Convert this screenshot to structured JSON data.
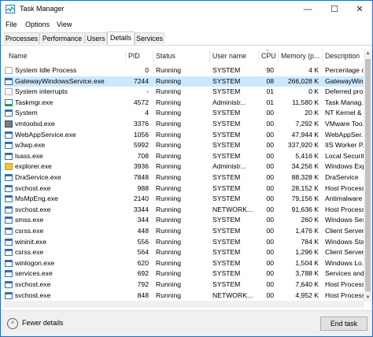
{
  "window": {
    "title": "Task Manager"
  },
  "menu": [
    "File",
    "Options",
    "View"
  ],
  "tabs": [
    {
      "label": "Processes",
      "active": false
    },
    {
      "label": "Performance",
      "active": false
    },
    {
      "label": "Users",
      "active": false
    },
    {
      "label": "Details",
      "active": true
    },
    {
      "label": "Services",
      "active": false
    }
  ],
  "table": {
    "columns": [
      "Name",
      "PID",
      "Status",
      "User name",
      "CPU",
      "Memory (p...",
      "Description"
    ],
    "rows": [
      {
        "name": "System Idle Process",
        "pid": "0",
        "status": "Running",
        "user": "SYSTEM",
        "cpu": "90",
        "memory": "4 K",
        "description": "Percentage of ...",
        "icon": "process-icon",
        "selected": false
      },
      {
        "name": "GatewayWindowsService.exe",
        "pid": "7244",
        "status": "Running",
        "user": "SYSTEM",
        "cpu": "08",
        "memory": "266,028 K",
        "description": "GatewayWin...",
        "icon": "window-icon",
        "selected": true
      },
      {
        "name": "System interrupts",
        "pid": "-",
        "status": "Running",
        "user": "SYSTEM",
        "cpu": "01",
        "memory": "0 K",
        "description": "Deferred pro...",
        "icon": "process-icon",
        "selected": false
      },
      {
        "name": "Taskmgr.exe",
        "pid": "4572",
        "status": "Running",
        "user": "Administr...",
        "cpu": "01",
        "memory": "11,580 K",
        "description": "Task Manag...",
        "icon": "taskmgr-icon",
        "selected": false
      },
      {
        "name": "System",
        "pid": "4",
        "status": "Running",
        "user": "SYSTEM",
        "cpu": "00",
        "memory": "20 K",
        "description": "NT Kernel & ...",
        "icon": "window-icon",
        "selected": false
      },
      {
        "name": "vmtoolsd.exe",
        "pid": "3376",
        "status": "Running",
        "user": "SYSTEM",
        "cpu": "00",
        "memory": "7,292 K",
        "description": "VMware Too...",
        "icon": "vm-icon",
        "selected": false
      },
      {
        "name": "WebAppService.exe",
        "pid": "1056",
        "status": "Running",
        "user": "SYSTEM",
        "cpu": "00",
        "memory": "47,944 K",
        "description": "WebAppSer...",
        "icon": "window-icon",
        "selected": false
      },
      {
        "name": "w3wp.exe",
        "pid": "5992",
        "status": "Running",
        "user": "SYSTEM",
        "cpu": "00",
        "memory": "337,920 K",
        "description": "IIS Worker P...",
        "icon": "window-icon",
        "selected": false
      },
      {
        "name": "lsass.exe",
        "pid": "708",
        "status": "Running",
        "user": "SYSTEM",
        "cpu": "00",
        "memory": "5,416 K",
        "description": "Local Securit...",
        "icon": "window-icon",
        "selected": false
      },
      {
        "name": "explorer.exe",
        "pid": "3936",
        "status": "Running",
        "user": "Administr...",
        "cpu": "00",
        "memory": "34,256 K",
        "description": "Windows Exp...",
        "icon": "folder-icon",
        "selected": false
      },
      {
        "name": "DraService.exe",
        "pid": "7848",
        "status": "Running",
        "user": "SYSTEM",
        "cpu": "00",
        "memory": "88,328 K",
        "description": "DraService",
        "icon": "window-icon",
        "selected": false
      },
      {
        "name": "svchost.exe",
        "pid": "988",
        "status": "Running",
        "user": "SYSTEM",
        "cpu": "00",
        "memory": "28,152 K",
        "description": "Host Process ...",
        "icon": "window-icon",
        "selected": false
      },
      {
        "name": "MsMpEng.exe",
        "pid": "2140",
        "status": "Running",
        "user": "SYSTEM",
        "cpu": "00",
        "memory": "79,156 K",
        "description": "Antimalware ...",
        "icon": "window-icon",
        "selected": false
      },
      {
        "name": "svchost.exe",
        "pid": "3344",
        "status": "Running",
        "user": "NETWORK...",
        "cpu": "00",
        "memory": "91,636 K",
        "description": "Host Process ...",
        "icon": "window-icon",
        "selected": false
      },
      {
        "name": "smss.exe",
        "pid": "344",
        "status": "Running",
        "user": "SYSTEM",
        "cpu": "00",
        "memory": "260 K",
        "description": "Windows Ses...",
        "icon": "window-icon",
        "selected": false
      },
      {
        "name": "csrss.exe",
        "pid": "448",
        "status": "Running",
        "user": "SYSTEM",
        "cpu": "00",
        "memory": "1,476 K",
        "description": "Client Server ...",
        "icon": "window-icon",
        "selected": false
      },
      {
        "name": "wininit.exe",
        "pid": "556",
        "status": "Running",
        "user": "SYSTEM",
        "cpu": "00",
        "memory": "784 K",
        "description": "Windows Sta...",
        "icon": "window-icon",
        "selected": false
      },
      {
        "name": "csrss.exe",
        "pid": "564",
        "status": "Running",
        "user": "SYSTEM",
        "cpu": "00",
        "memory": "1,296 K",
        "description": "Client Server ...",
        "icon": "window-icon",
        "selected": false
      },
      {
        "name": "winlogon.exe",
        "pid": "620",
        "status": "Running",
        "user": "SYSTEM",
        "cpu": "00",
        "memory": "1,504 K",
        "description": "Windows Lo...",
        "icon": "window-icon",
        "selected": false
      },
      {
        "name": "services.exe",
        "pid": "692",
        "status": "Running",
        "user": "SYSTEM",
        "cpu": "00",
        "memory": "3,788 K",
        "description": "Services and ...",
        "icon": "window-icon",
        "selected": false
      },
      {
        "name": "svchost.exe",
        "pid": "792",
        "status": "Running",
        "user": "SYSTEM",
        "cpu": "00",
        "memory": "7,640 K",
        "description": "Host Process ...",
        "icon": "window-icon",
        "selected": false
      },
      {
        "name": "svchost.exe",
        "pid": "848",
        "status": "Running",
        "user": "NETWORK...",
        "cpu": "00",
        "memory": "4,952 K",
        "description": "Host Process ...",
        "icon": "window-icon",
        "selected": false
      }
    ]
  },
  "footer": {
    "fewer_details": "Fewer details",
    "end_task": "End task"
  },
  "colors": {
    "accent": "#1e6fc0",
    "selection": "#cce8ff"
  }
}
